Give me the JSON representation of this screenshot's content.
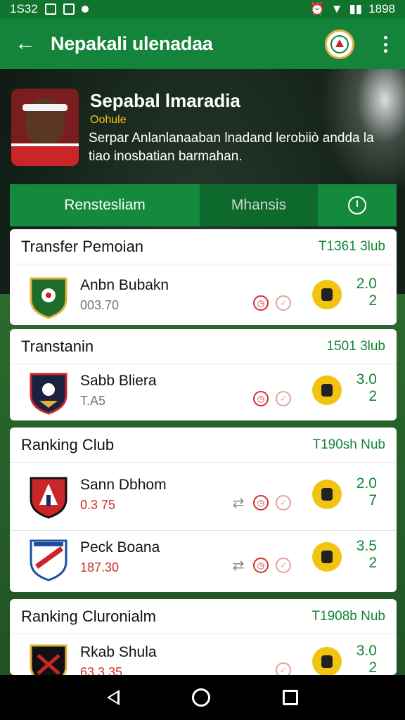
{
  "status": {
    "time": "1S32",
    "right_time": "1898"
  },
  "appbar": {
    "title": "Nepakali ulenadaa"
  },
  "profile": {
    "name": "Sepabal lmaradia",
    "subtitle": "Oohule",
    "description": "Serpar Anlanlanaaban lnadand lerobiiò andda la tiao inosbatian barmahan."
  },
  "tabs": [
    {
      "label": "Renstesliam"
    },
    {
      "label": "Mhansis"
    }
  ],
  "cards": [
    {
      "title": "Transfer Pemoian",
      "meta": "T1361 3lub",
      "rows": [
        {
          "name": "Anbn Bubakn",
          "code": "003.70",
          "score_top": "2.0",
          "score_bottom": "2"
        }
      ]
    },
    {
      "title": "Transtanin",
      "meta": "1501 3lub",
      "rows": [
        {
          "name": "Sabb Bliera",
          "code": "T.A5",
          "score_top": "3.0",
          "score_bottom": "2"
        }
      ]
    },
    {
      "title": "Ranking Club",
      "meta": "T190sh Nub",
      "rows": [
        {
          "name": "Sann Dbhom",
          "code": "0.3 75",
          "score_top": "2.0",
          "score_bottom": "7"
        },
        {
          "name": "Peck Boana",
          "code": "187.30",
          "score_top": "3.5",
          "score_bottom": "2"
        }
      ]
    },
    {
      "title": "Ranking Cluronialm",
      "meta": "T1908b Nub",
      "rows": [
        {
          "name": "Rkab Shula",
          "code": "63.3 35",
          "score_top": "3.0",
          "score_bottom": "2"
        }
      ]
    }
  ],
  "colors": {
    "primary": "#13843a",
    "accent": "#f1c40f",
    "danger": "#d0312d"
  }
}
